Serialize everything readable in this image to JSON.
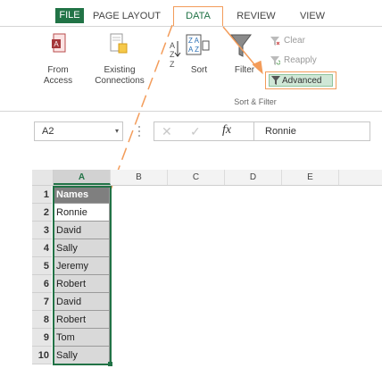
{
  "ribbon": {
    "tabs": [
      {
        "label": "FILE"
      },
      {
        "label": "PAGE LAYOUT"
      },
      {
        "label": "DATA"
      },
      {
        "label": "REVIEW"
      },
      {
        "label": "VIEW"
      }
    ],
    "buttons": {
      "from_access": "From\nAccess",
      "from_access_line1": "From",
      "from_access_line2": "Access",
      "existing_line1": "Existing",
      "existing_line2": "Connections",
      "sort": "Sort",
      "filter": "Filter",
      "clear": "Clear",
      "reapply": "Reapply",
      "advanced": "Advanced"
    },
    "group_label": "Sort & Filter"
  },
  "formula_bar": {
    "name_box": "A2",
    "fx": "fx",
    "content": "Ronnie"
  },
  "sheet": {
    "columns": [
      "A",
      "B",
      "C",
      "D",
      "E"
    ],
    "rows": [
      {
        "num": "1",
        "value": "Names"
      },
      {
        "num": "2",
        "value": "Ronnie"
      },
      {
        "num": "3",
        "value": "David"
      },
      {
        "num": "4",
        "value": "Sally"
      },
      {
        "num": "5",
        "value": "Jeremy"
      },
      {
        "num": "6",
        "value": "Robert"
      },
      {
        "num": "7",
        "value": "David"
      },
      {
        "num": "8",
        "value": "Robert"
      },
      {
        "num": "9",
        "value": "Tom"
      },
      {
        "num": "10",
        "value": "Sally"
      }
    ]
  },
  "colors": {
    "excel_green": "#217346",
    "highlight_orange": "#f39c5a",
    "header_fill": "#7f7f7f",
    "selection_fill": "#d9d9d9"
  }
}
